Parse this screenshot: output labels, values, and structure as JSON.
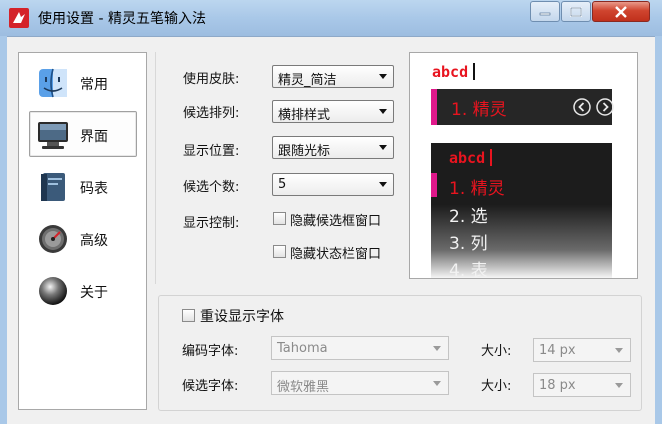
{
  "window": {
    "title": "使用设置 - 精灵五笔输入法"
  },
  "nav": {
    "items": [
      {
        "label": "常用",
        "icon": "finder-face-icon"
      },
      {
        "label": "界面",
        "icon": "monitor-icon"
      },
      {
        "label": "码表",
        "icon": "book-icon"
      },
      {
        "label": "高级",
        "icon": "gauge-icon"
      },
      {
        "label": "关于",
        "icon": "sphere-icon"
      }
    ],
    "selected": "界面"
  },
  "settings": {
    "skin_label": "使用皮肤:",
    "skin_value": "精灵_简洁",
    "layout_label": "候选排列:",
    "layout_value": "横排样式",
    "position_label": "显示位置:",
    "position_value": "跟随光标",
    "count_label": "候选个数:",
    "count_value": "5",
    "display_label": "显示控制:",
    "hide_candidate_window": "隐藏候选框窗口",
    "hide_status_window": "隐藏状态栏窗口"
  },
  "preview": {
    "input_text": "abcd",
    "horizontal_candidate": "1. 精灵",
    "vertical_candidates": [
      "1. 精灵",
      "2. 选",
      "3. 列",
      "4. 表"
    ]
  },
  "font_group": {
    "reset_label": "重设显示字体",
    "code_font_label": "编码字体:",
    "code_font_value": "Tahoma",
    "code_size_label": "大小:",
    "code_size_value": "14 px",
    "cand_font_label": "候选字体:",
    "cand_font_value": "微软雅黑",
    "cand_size_label": "大小:",
    "cand_size_value": "18 px"
  },
  "colors": {
    "accent_red": "#e8141f",
    "accent_pink": "#e0188b",
    "title_bar": "#a9c8e8",
    "close_button": "#c9402d"
  }
}
